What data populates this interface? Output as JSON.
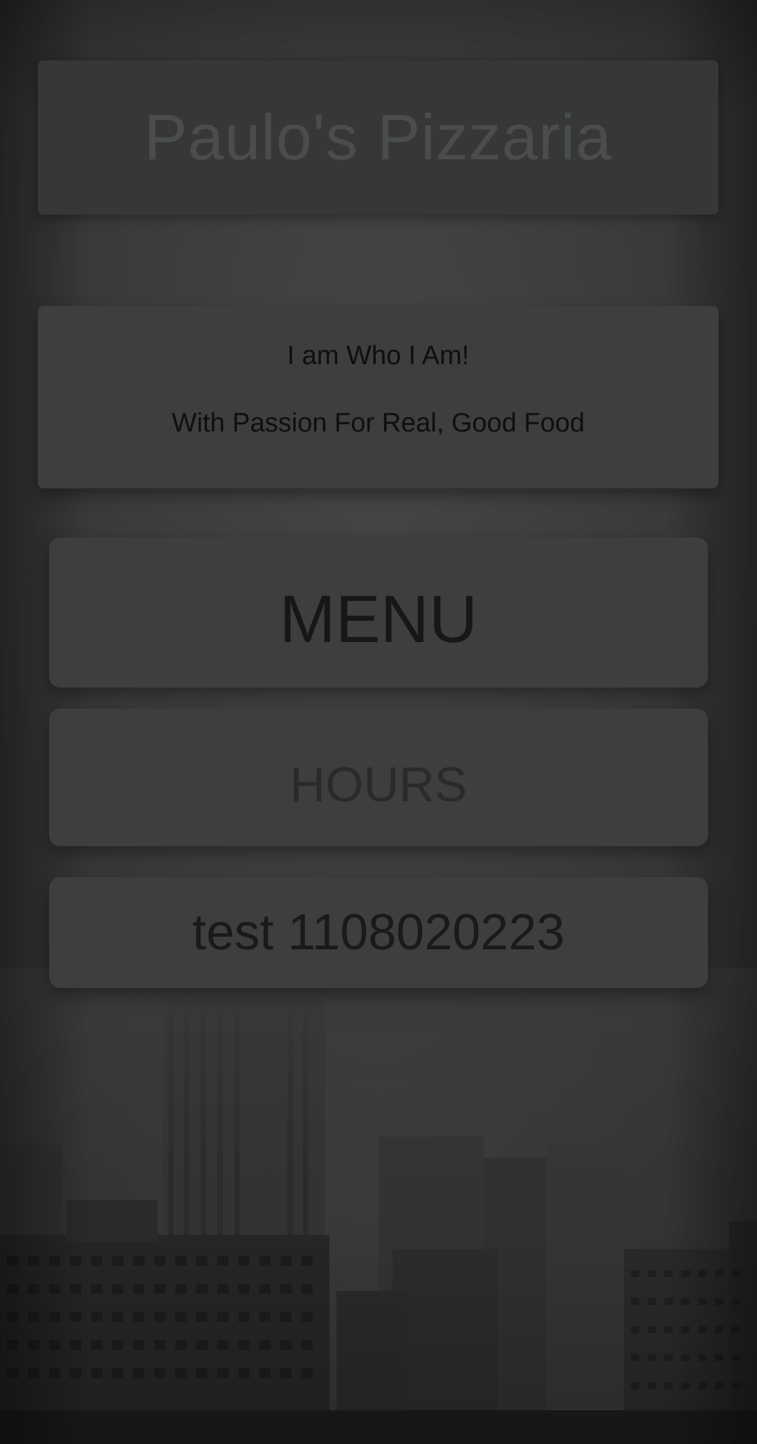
{
  "header": {
    "title": "Paulo's Pizzaria"
  },
  "intro": {
    "line1": "I am Who I Am!",
    "line2": "With Passion For Real, Good Food"
  },
  "nav": {
    "menu_label": "MENU",
    "hours_label": "HOURS",
    "test_label": "test 1108020223"
  },
  "background": {
    "icon": "city-skyline-background"
  },
  "colors": {
    "background": "#3a3a3a",
    "card": "#3e3e3e",
    "header": "#353836",
    "text_dark": "#0f0f0f"
  }
}
